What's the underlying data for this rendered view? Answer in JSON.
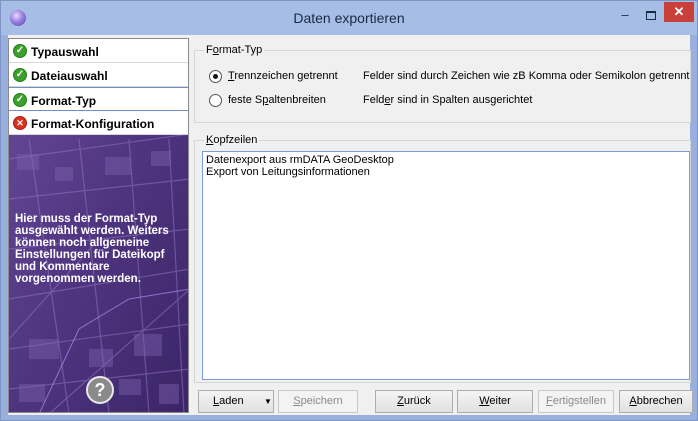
{
  "window": {
    "title": "Daten exportieren"
  },
  "titlebar": {
    "minimize_glyph": "–",
    "close_glyph": "✕"
  },
  "sidebar": {
    "steps": [
      {
        "label": "Typauswahl",
        "status": "ok"
      },
      {
        "label": "Dateiauswahl",
        "status": "ok"
      },
      {
        "label": "Format-Typ",
        "status": "ok",
        "current": true
      },
      {
        "label": "Format-Konfiguration",
        "status": "error"
      }
    ],
    "status_glyphs": {
      "ok": "✓",
      "error": "✕"
    },
    "help_text": "Hier muss der Format-Typ ausgewählt werden. Weiters können noch allgemeine Einstellungen für Dateikopf und Kommentare vorgenommen werden.",
    "help_button": "?"
  },
  "format_typ": {
    "title_prefix": "F",
    "title_u": "o",
    "title_rest": "rmat-Typ",
    "options": [
      {
        "label_u": "T",
        "label_rest": "rennzeichen getrennt",
        "desc_pre": "Felder sind durch Zeichen wie zB Komma oder Semikolon getrennt",
        "checked": true
      },
      {
        "label_pre": "feste S",
        "label_u": "p",
        "label_rest": "altenbreiten",
        "desc_pre": "Feld",
        "desc_u": "e",
        "desc_rest": "r sind in Spalten ausgerichtet",
        "checked": false
      }
    ]
  },
  "kopfzeilen": {
    "title_u": "K",
    "title_rest": "opfzeilen",
    "lines": [
      "Datenexport aus rmDATA GeoDesktop",
      "Export von Leitungsinformationen"
    ]
  },
  "buttons": {
    "laden": {
      "u": "L",
      "rest": "aden",
      "arrow": "▼"
    },
    "speichern": {
      "u": "S",
      "rest": "peichern"
    },
    "zurueck": {
      "u": "Z",
      "rest": "urück"
    },
    "weiter": {
      "u": "W",
      "rest": "eiter"
    },
    "fertigstellen": {
      "u": "F",
      "rest": "ertigstellen"
    },
    "abbrechen": {
      "u": "A",
      "rest": "bbrechen"
    }
  },
  "colors": {
    "titlebar": "#a6bde6",
    "sidebar_bg": "#4a2f78",
    "ok": "#3aa12a",
    "error": "#d8321f",
    "close": "#c7403a"
  }
}
